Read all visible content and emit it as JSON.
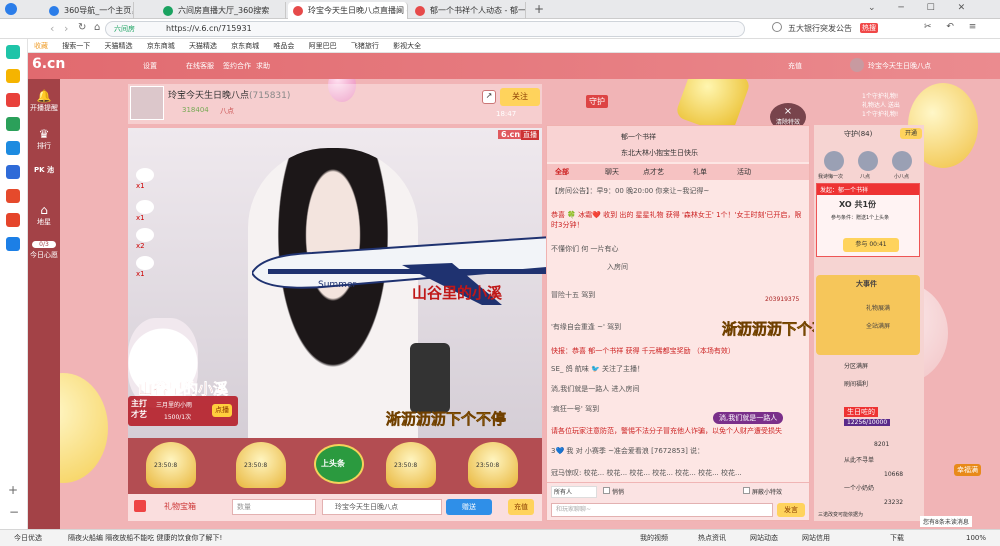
{
  "browser": {
    "tabs": [
      {
        "label": "360导航_一个主页，整个世界",
        "color": "#2b7de9"
      },
      {
        "label": "六间房直播大厅_360搜索",
        "color": "#1aa260"
      },
      {
        "label": "玲宝今天生日晚八点直播间 - 或",
        "color": "#e64a4a",
        "active": true
      },
      {
        "label": "郁一个书祥个人动态 - 郁一个书",
        "color": "#e64a4a"
      }
    ],
    "add_tab": "+",
    "url": "https://v.6.cn/715931",
    "site_badge": "六间房",
    "search_hint": "五大银行突发公告",
    "hot_badge": "热搜",
    "bookmarks": [
      "收藏",
      "搜索一下",
      "天猫精选",
      "京东商城",
      "天猫精选",
      "京东商城",
      "唯品会",
      "阿里巴巴",
      "飞猪旅行",
      "影视大全"
    ]
  },
  "site": {
    "logo": "6.cn",
    "header_links": [
      "设置",
      "在线客服",
      "签约合作",
      "求助"
    ],
    "nav": [
      {
        "label": "开播提醒"
      },
      {
        "label": "排行"
      },
      {
        "label": "PK 池"
      },
      {
        "label": "地星"
      },
      {
        "label": "今日心愿",
        "badge": "0/3"
      }
    ],
    "right_header": [
      "充值",
      "玲宝今天生日晚八点"
    ]
  },
  "host": {
    "name": "玲宝今天生日晚八点",
    "room_id": "(715831)",
    "fans": "318404",
    "level": "八点",
    "follow_label": "关注",
    "guard_label": "守护",
    "time": "18:47",
    "clear_effects": "清除特效"
  },
  "player": {
    "watermark": "6.cn",
    "live_badge": "直播",
    "ranks": [
      "x1",
      "x1",
      "x2",
      "x1"
    ],
    "overlay_top": "山谷里的小溪",
    "overlay_left": "山谷里的小溪",
    "overlay_bottom": "淅沥沥沥下个不停",
    "plane_label": "Summer",
    "host_tag_title": "主打才艺",
    "host_tag_sub": "三月里的小雨",
    "host_tag_count": "1500/1次",
    "host_tag_btn": "点播"
  },
  "seats": [
    {
      "label": "23:50:8"
    },
    {
      "label": "23:50:8"
    },
    {
      "label": "上头条"
    },
    {
      "label": "23:50:8"
    },
    {
      "label": "23:50:8"
    }
  ],
  "gift_bar": {
    "label": "礼物宝箱",
    "qty_placeholder": "数量",
    "target": "玲宝今天生日晚八点",
    "send": "赠送",
    "recharge": "充值"
  },
  "chat": {
    "top_user": "郁一个书祥",
    "top_user2": "东北大林小抱宝生日快乐",
    "tabs": [
      "全部",
      "聊天",
      "点才艺",
      "礼单",
      "活动"
    ],
    "notice": "【房间公告】：早9：00 晚20:00 你来让~我记得~",
    "lines": [
      "恭喜 🍀 冰霜❤️ 收到 出的 星星礼物 获得 '森林女王' 1个！'女王时刻'已开启，限时3分钟！",
      "不懂你们 何 一片有心",
      "入房间",
      "冒险十五 驾到",
      "'有缘自会重逢 ~' 驾到",
      "快报：恭喜 郁一个书祥 获得 千元稀都宝奖励 （本场有效）",
      "SE_ 鸽 航味 🐦 关注了主播！",
      "淌,我们就是一路人 进入房间",
      "'疯狂一号' 驾到",
      "请各位玩家注意防范，警惕不法分子冒充他人诈骗，以免个人财产遭受损失",
      "3💙 我 对 小赛季 ~准会爱看浪 [7672853] 说：",
      "冠马惊叹: 校花... 校花... 校花... 校花... 校花... 校花... 校花..."
    ],
    "danmu": "淅沥沥沥下个不停",
    "danmu2": "淌,我们就是一路人",
    "input_placeholder": "和玩家聊聊~",
    "audience": "所有人",
    "whisper": "悄悄",
    "screen_hide": "屏蔽小特效",
    "send": "发言",
    "bonus_num": "203919375"
  },
  "right": {
    "guard_title": "守护(84)",
    "open": "开通",
    "guards": [
      "我诗悔一次",
      "八点",
      "小八点"
    ],
    "invite_title": "发起：郁一个书祥",
    "xo_label": "XO 共1份",
    "xo_sub": "参与条件：赠送1个上头条",
    "join": "参与",
    "timer": "00:41",
    "event": "大事件",
    "gift_show": "礼物展满",
    "full_show": "全站满屏",
    "city_show": "分区满屏",
    "benefit": "刷间福利",
    "birthday_tag": "生日咗的",
    "birthday_num": "12256/10000",
    "list": [
      "8201",
      "从此不寻单",
      "10668",
      "一个小奶奶",
      "23232",
      "三诺改变可能依据为"
    ],
    "bottom_label": "您有8条未读消息"
  },
  "floating": {
    "ranks_right": [
      "1个守护礼物!",
      "礼物达人 送出",
      "1个守护礼物!"
    ],
    "badge_right": "幸福满"
  },
  "statusbar": {
    "left": "今日优选",
    "news": "隔夜火船编 隔夜放船不能吃 健康的饮食你了解下!",
    "right": [
      "我的视频",
      "热点资讯",
      "网站动态",
      "网站信用",
      "下载",
      "100%"
    ]
  }
}
